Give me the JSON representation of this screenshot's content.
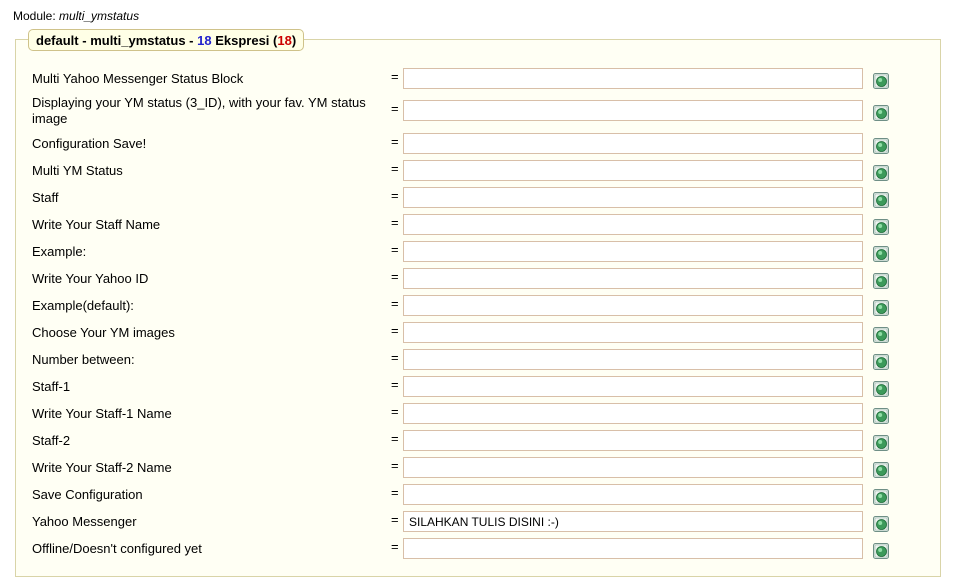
{
  "module": {
    "prefix": "Module:",
    "name": "multi_ymstatus"
  },
  "legend": {
    "lang": "default",
    "sep1": " - ",
    "module": "multi_ymstatus",
    "sep2": " - ",
    "count_num": "18",
    "word": " Ekspresi (",
    "count_paren": "18",
    "close": ")"
  },
  "rows": [
    {
      "label": "Multi Yahoo Messenger Status Block",
      "value": ""
    },
    {
      "label": "Displaying your YM status (3_ID), with your fav. YM status image",
      "value": ""
    },
    {
      "label": "Configuration Save!",
      "value": ""
    },
    {
      "label": "Multi YM Status",
      "value": ""
    },
    {
      "label": "Staff",
      "value": ""
    },
    {
      "label": "Write Your Staff Name",
      "value": ""
    },
    {
      "label": "Example:",
      "value": ""
    },
    {
      "label": "Write Your Yahoo ID",
      "value": ""
    },
    {
      "label": "Example(default):",
      "value": ""
    },
    {
      "label": "Choose Your YM images",
      "value": ""
    },
    {
      "label": "Number between:",
      "value": ""
    },
    {
      "label": "Staff-1",
      "value": ""
    },
    {
      "label": "Write Your Staff-1 Name",
      "value": ""
    },
    {
      "label": "Staff-2",
      "value": ""
    },
    {
      "label": "Write Your Staff-2 Name",
      "value": ""
    },
    {
      "label": "Save Configuration",
      "value": ""
    },
    {
      "label": "Yahoo Messenger",
      "value": "SILAHKAN TULIS DISINI :-)"
    },
    {
      "label": "Offline/Doesn't configured yet",
      "value": ""
    }
  ],
  "eq_sign": "=",
  "icon": "save-icon"
}
